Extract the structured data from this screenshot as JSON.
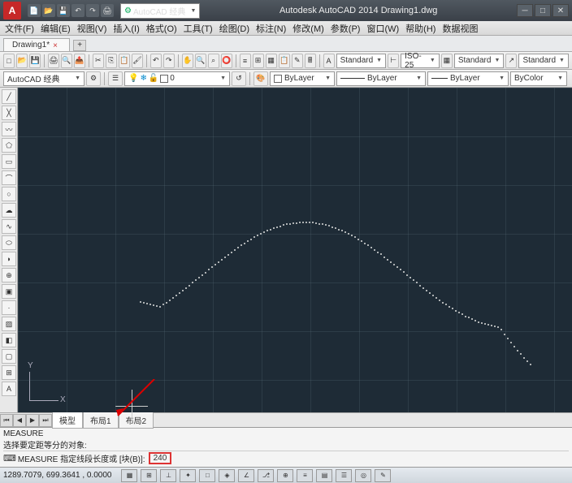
{
  "title": "Autodesk AutoCAD 2014   Drawing1.dwg",
  "workspace_selector": "AutoCAD 经典",
  "menu": [
    "文件(F)",
    "编辑(E)",
    "视图(V)",
    "插入(I)",
    "格式(O)",
    "工具(T)",
    "绘图(D)",
    "标注(N)",
    "修改(M)",
    "参数(P)",
    "窗口(W)",
    "帮助(H)",
    "数据视图"
  ],
  "file_tab": "Drawing1*",
  "row1": {
    "workspace_dd": "AutoCAD 经典",
    "style1": "Standard",
    "style2": "ISO-25",
    "style3": "Standard",
    "style4": "Standard"
  },
  "row2": {
    "layer": "0",
    "linetype_display": "ByLayer",
    "lineweight": "ByLayer",
    "color": "ByColor"
  },
  "layout_tabs": {
    "model": "模型",
    "l1": "布局1",
    "l2": "布局2"
  },
  "cmd": {
    "line0": "MEASURE",
    "line1": "选择要定距等分的对象:",
    "prompt": "MEASURE 指定线段长度或 [块(B)]:",
    "input": "240"
  },
  "status": {
    "coords": "1289.7079, 699.3641 , 0.0000"
  },
  "ucs": {
    "x": "X",
    "y": "Y"
  }
}
